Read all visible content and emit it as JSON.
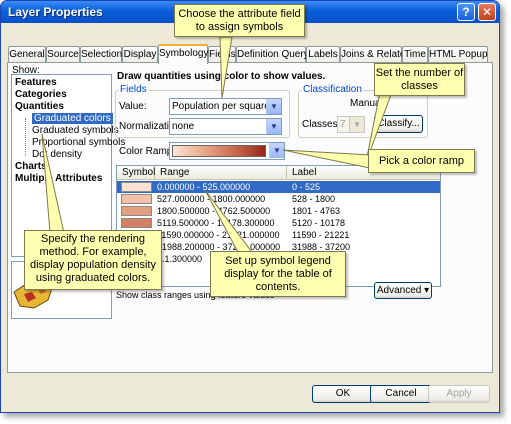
{
  "window": {
    "title": "Layer Properties",
    "help_label": "?",
    "close_label": "✕"
  },
  "tabs": [
    {
      "label": "General"
    },
    {
      "label": "Source"
    },
    {
      "label": "Selection"
    },
    {
      "label": "Display"
    },
    {
      "label": "Symbology"
    },
    {
      "label": "Fields"
    },
    {
      "label": "Definition Query"
    },
    {
      "label": "Labels"
    },
    {
      "label": "Joins & Relates"
    },
    {
      "label": "Time"
    },
    {
      "label": "HTML Popup"
    }
  ],
  "show": {
    "label": "Show:",
    "items": [
      {
        "label": "Features"
      },
      {
        "label": "Categories"
      },
      {
        "label": "Quantities"
      },
      {
        "label": "Graduated colors"
      },
      {
        "label": "Graduated symbols"
      },
      {
        "label": "Proportional symbols"
      },
      {
        "label": "Dot density"
      },
      {
        "label": "Charts"
      },
      {
        "label": "Multiple Attributes"
      }
    ]
  },
  "main": {
    "heading": "Draw quantities using color to show values.",
    "fields_title": "Fields",
    "value_label": "Value:",
    "value": "Population per square mile",
    "normalization_label": "Normalization:",
    "normalization": "none",
    "classification_title": "Classification",
    "classification_method": "Manual",
    "classes_label": "Classes:",
    "classes_value": "7",
    "classify_label": "Classify...",
    "color_ramp_label": "Color Ramp:",
    "table_headers": {
      "symbol": "Symbol",
      "range": "Range",
      "label": "Label"
    },
    "rows": [
      {
        "range": "0.000000 - 525.000000",
        "label": "0 - 525",
        "color": "#fbe3d3"
      },
      {
        "range": "527.000000 - 1800.000000",
        "label": "528 - 1800",
        "color": "#f1c2a9"
      },
      {
        "range": "1800.500000 - 4762.500000",
        "label": "1801 - 4763",
        "color": "#e3a081"
      },
      {
        "range": "5119.500000 - 10178.300000",
        "label": "5120 - 10178",
        "color": "#d58065"
      },
      {
        "range": "11590.000000 - 21221.000000",
        "label": "11590 - 21221",
        "color": "#c5624c"
      },
      {
        "range": "31988.200000 - 37200.000000",
        "label": "31988 - 37200",
        "color": "#b44535"
      },
      {
        "range": "...1.300000",
        "label": "",
        "color": "#9c2a1e"
      }
    ],
    "show_class_ranges": "Show class ranges using feature values",
    "advanced_label": "Advanced"
  },
  "footer": {
    "ok": "OK",
    "cancel": "Cancel",
    "apply": "Apply"
  },
  "callouts": {
    "attribute": "Choose the attribute field to assign symbols",
    "classes": "Set the number of classes",
    "ramp": "Pick a color ramp",
    "legend": "Set up symbol legend display for the table of contents.",
    "method": "Specify the rendering method. For example, display population density using graduated colors."
  }
}
